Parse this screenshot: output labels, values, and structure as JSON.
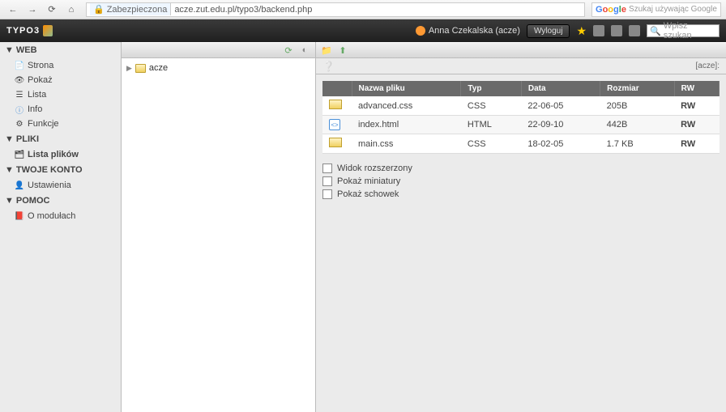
{
  "browser": {
    "secure_label": "Zabezpieczona",
    "url": "acze.zut.edu.pl/typo3/backend.php",
    "search_placeholder": "Szukaj używając Google"
  },
  "header": {
    "logo": "TYPO3",
    "user": "Anna Czekalska (acze)",
    "logout": "Wyloguj",
    "search_placeholder": "Wpisz szukan"
  },
  "sidebar": {
    "sections": {
      "web": "WEB",
      "pliki": "PLIKI",
      "konto": "TWOJE KONTO",
      "pomoc": "POMOC"
    },
    "web_items": [
      "Strona",
      "Pokaż",
      "Lista",
      "Info",
      "Funkcje"
    ],
    "pliki_items": [
      "Lista plików"
    ],
    "konto_items": [
      "Ustawienia"
    ],
    "pomoc_items": [
      "O modułach"
    ]
  },
  "tree": {
    "root": "acze"
  },
  "breadcrumb": "[acze]:",
  "file_table": {
    "headers": {
      "name": "Nazwa pliku",
      "type": "Typ",
      "date": "Data",
      "size": "Rozmiar",
      "rw": "RW"
    },
    "rows": [
      {
        "icon": "css",
        "name": "advanced.css",
        "type": "CSS",
        "date": "22-06-05",
        "size": "205B",
        "rw": "RW"
      },
      {
        "icon": "html",
        "name": "index.html",
        "type": "HTML",
        "date": "22-09-10",
        "size": "442B",
        "rw": "RW"
      },
      {
        "icon": "css",
        "name": "main.css",
        "type": "CSS",
        "date": "18-02-05",
        "size": "1.7 KB",
        "rw": "RW"
      }
    ]
  },
  "checks": [
    "Widok rozszerzony",
    "Pokaż miniatury",
    "Pokaż schowek"
  ]
}
